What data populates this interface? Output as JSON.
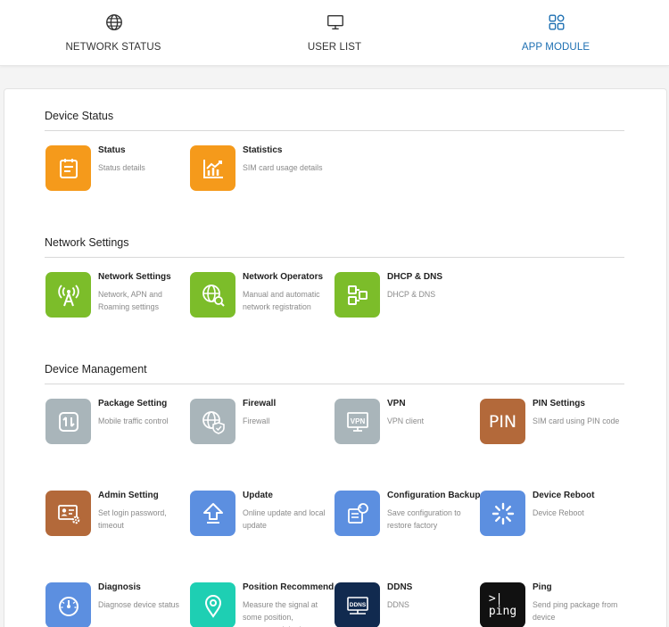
{
  "tabs": [
    {
      "label": "NETWORK STATUS",
      "icon": "globe-icon"
    },
    {
      "label": "USER LIST",
      "icon": "monitor-icon"
    },
    {
      "label": "APP MODULE",
      "icon": "grid-icon"
    }
  ],
  "active_tab": "APP MODULE",
  "colors": {
    "active": "#1d6fb2",
    "orange": "#f59a1b",
    "green": "#7cbd2a",
    "gray": "#a9b5ba",
    "brown": "#b3693a",
    "blue": "#5c8fe0",
    "teal": "#1ecfb3",
    "navy": "#112a4f",
    "black": "#111111"
  },
  "sections": {
    "device_status": {
      "title": "Device Status",
      "items": [
        {
          "title": "Status",
          "desc": "Status details",
          "icon": "clipboard-icon"
        },
        {
          "title": "Statistics",
          "desc": "SIM card usage details",
          "icon": "chart-icon"
        }
      ]
    },
    "network_settings": {
      "title": "Network Settings",
      "items": [
        {
          "title": "Network Settings",
          "desc": "Network, APN and Roaming settings",
          "icon": "antenna-icon"
        },
        {
          "title": "Network Operators",
          "desc": "Manual and automatic network registration",
          "icon": "globe-search-icon"
        },
        {
          "title": "DHCP & DNS",
          "desc": "DHCP & DNS",
          "icon": "dhcp-icon"
        }
      ]
    },
    "device_management": {
      "title": "Device Management",
      "items": [
        {
          "title": "Package Setting",
          "desc": "Mobile traffic control",
          "icon": "package-icon"
        },
        {
          "title": "Firewall",
          "desc": "Firewall",
          "icon": "firewall-icon"
        },
        {
          "title": "VPN",
          "desc": "VPN client",
          "icon": "vpn-icon",
          "glyph": "VPN"
        },
        {
          "title": "PIN Settings",
          "desc": "SIM card using PIN code",
          "icon": "pin-icon",
          "glyph": "PIN"
        },
        {
          "title": "Admin Setting",
          "desc": "Set login password, timeout",
          "icon": "admin-icon"
        },
        {
          "title": "Update",
          "desc": "Online update and local update",
          "icon": "update-icon"
        },
        {
          "title": "Configuration Backup",
          "desc": "Save configuration to restore factory",
          "icon": "backup-icon"
        },
        {
          "title": "Device Reboot",
          "desc": "Device Reboot",
          "icon": "reboot-icon"
        },
        {
          "title": "Diagnosis",
          "desc": "Diagnose device status",
          "icon": "gauge-icon"
        },
        {
          "title": "Position Recommend",
          "desc": "Measure the signal at some position, recommend the best position",
          "icon": "location-icon"
        },
        {
          "title": "DDNS",
          "desc": "DDNS",
          "icon": "ddns-icon",
          "glyph": "DDNS"
        },
        {
          "title": "Ping",
          "desc": "Send ping package from device",
          "icon": "terminal-icon",
          "glyph_line1": ">|",
          "glyph_line2": "ping"
        }
      ]
    }
  }
}
